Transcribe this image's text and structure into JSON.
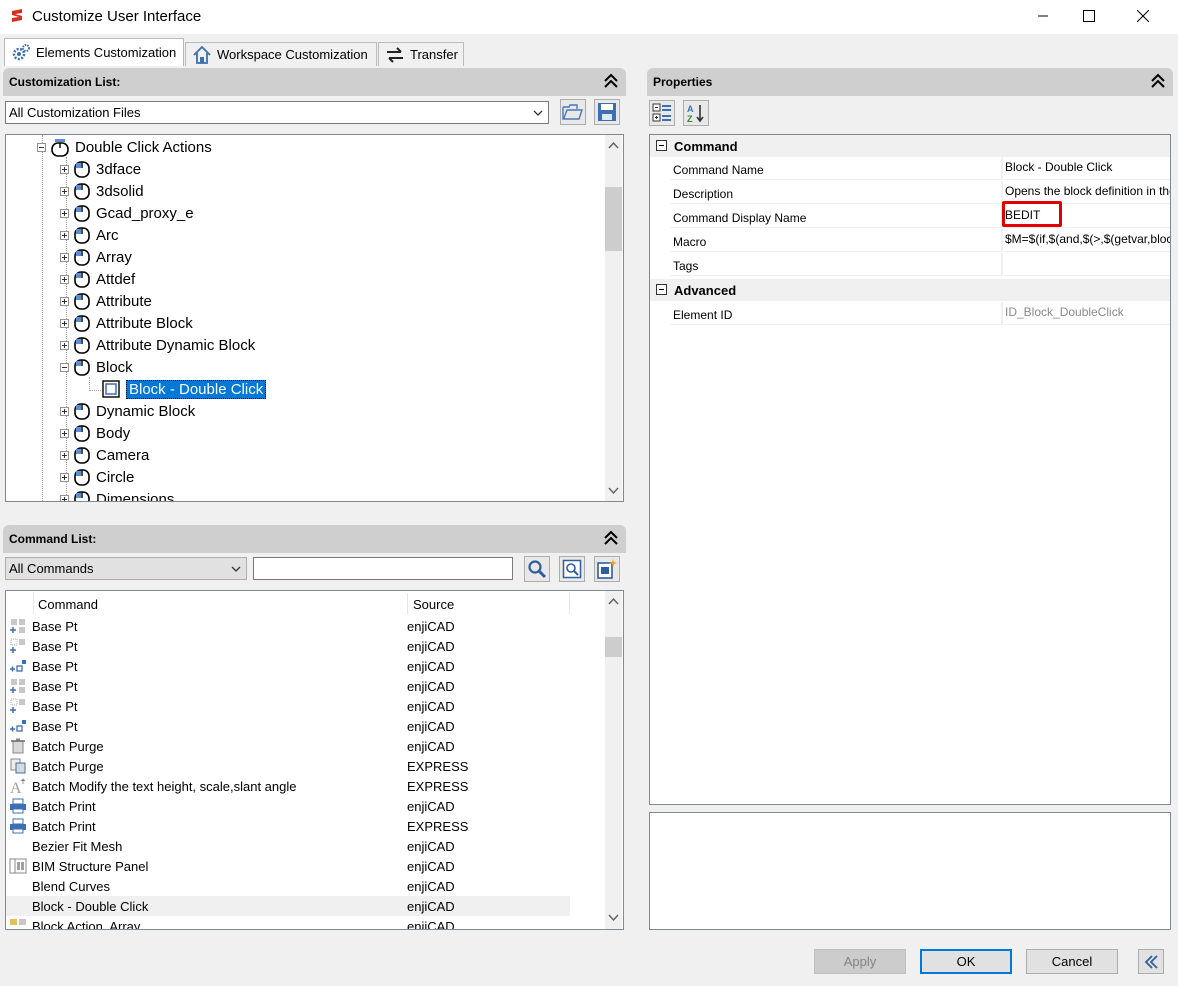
{
  "window": {
    "title": "Customize User Interface"
  },
  "tabs": [
    {
      "label": "Elements Customization",
      "active": true
    },
    {
      "label": "Workspace Customization",
      "active": false
    },
    {
      "label": "Transfer",
      "active": false
    }
  ],
  "customization_list": {
    "header": "Customization List:",
    "file_select": "All Customization Files",
    "tree": [
      {
        "label": "Double Click Actions",
        "expanded": true
      },
      {
        "label": "3dface"
      },
      {
        "label": "3dsolid"
      },
      {
        "label": "Gcad_proxy_e"
      },
      {
        "label": "Arc"
      },
      {
        "label": "Array"
      },
      {
        "label": "Attdef"
      },
      {
        "label": "Attribute"
      },
      {
        "label": "Attribute Block"
      },
      {
        "label": "Attribute Dynamic Block"
      },
      {
        "label": "Block",
        "expanded": true
      },
      {
        "label": "Block - Double Click",
        "selected": true
      },
      {
        "label": "Dynamic Block"
      },
      {
        "label": "Body"
      },
      {
        "label": "Camera"
      },
      {
        "label": "Circle"
      },
      {
        "label": "Dimensions"
      }
    ]
  },
  "command_list": {
    "header": "Command List:",
    "filter": "All Commands",
    "search_value": "",
    "columns": {
      "command": "Command",
      "source": "Source"
    },
    "rows": [
      {
        "command": "Base Pt",
        "source": "enjiCAD"
      },
      {
        "command": "Base Pt",
        "source": "enjiCAD"
      },
      {
        "command": "Base Pt",
        "source": "enjiCAD"
      },
      {
        "command": "Base Pt",
        "source": "enjiCAD"
      },
      {
        "command": "Base Pt",
        "source": "enjiCAD"
      },
      {
        "command": "Base Pt",
        "source": "enjiCAD"
      },
      {
        "command": "Batch Purge",
        "source": "enjiCAD"
      },
      {
        "command": "Batch Purge",
        "source": "EXPRESS"
      },
      {
        "command": "Batch Modify the text height, scale,slant angle",
        "source": "EXPRESS"
      },
      {
        "command": "Batch Print",
        "source": "enjiCAD"
      },
      {
        "command": "Batch Print",
        "source": "EXPRESS"
      },
      {
        "command": "Bezier Fit Mesh",
        "source": "enjiCAD"
      },
      {
        "command": "BIM Structure Panel",
        "source": "enjiCAD"
      },
      {
        "command": "Blend Curves",
        "source": "enjiCAD"
      },
      {
        "command": "Block - Double Click",
        "source": "enjiCAD",
        "highlighted": true
      },
      {
        "command": "Block Action, Array",
        "source": "enjiCAD"
      }
    ]
  },
  "properties": {
    "header": "Properties",
    "categories": {
      "command": "Command",
      "advanced": "Advanced"
    },
    "rows": {
      "command_name": {
        "name": "Command Name",
        "value": "Block - Double Click"
      },
      "description": {
        "name": "Description",
        "value": "Opens the block definition in the Bl"
      },
      "display_name": {
        "name": "Command Display Name",
        "value": "BEDIT"
      },
      "macro": {
        "name": "Macro",
        "value": "$M=$(if,$(and,$(>,$(getvar,blockec"
      },
      "tags": {
        "name": "Tags",
        "value": ""
      },
      "element_id": {
        "name": "Element ID",
        "value": "ID_Block_DoubleClick"
      }
    }
  },
  "buttons": {
    "apply": "Apply",
    "ok": "OK",
    "cancel": "Cancel"
  },
  "colors": {
    "selection": "#0078d7",
    "highlight_box": "#e00000",
    "panel_header": "#cfcfcf"
  }
}
